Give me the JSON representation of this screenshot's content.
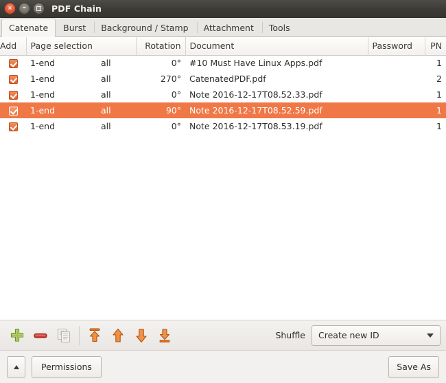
{
  "window": {
    "title": "PDF Chain",
    "controls": [
      {
        "name": "close",
        "glyph": "×"
      },
      {
        "name": "minimize",
        "glyph": "–"
      },
      {
        "name": "maximize",
        "glyph": ""
      }
    ]
  },
  "tabs": [
    {
      "label": "Catenate",
      "active": true
    },
    {
      "label": "Burst",
      "active": false
    },
    {
      "label": "Background / Stamp",
      "active": false
    },
    {
      "label": "Attachment",
      "active": false
    },
    {
      "label": "Tools",
      "active": false
    }
  ],
  "table": {
    "columns": [
      {
        "key": "add",
        "label": "Add"
      },
      {
        "key": "page",
        "label": "Page selection"
      },
      {
        "key": "rotation",
        "label": "Rotation"
      },
      {
        "key": "document",
        "label": "Document"
      },
      {
        "key": "password",
        "label": "Password"
      },
      {
        "key": "pn",
        "label": "PN"
      }
    ],
    "rows": [
      {
        "add": true,
        "page": "1-end",
        "all": "all",
        "rotation": "0°",
        "document": "#10 Must Have Linux Apps.pdf",
        "password": "",
        "pn": "1",
        "selected": false
      },
      {
        "add": true,
        "page": "1-end",
        "all": "all",
        "rotation": "270°",
        "document": "CatenatedPDF.pdf",
        "password": "",
        "pn": "2",
        "selected": false
      },
      {
        "add": true,
        "page": "1-end",
        "all": "all",
        "rotation": "0°",
        "document": "Note 2016-12-17T08.52.33.pdf",
        "password": "",
        "pn": "1",
        "selected": false
      },
      {
        "add": true,
        "page": "1-end",
        "all": "all",
        "rotation": "90°",
        "document": "Note 2016-12-17T08.52.59.pdf",
        "password": "",
        "pn": "1",
        "selected": true
      },
      {
        "add": true,
        "page": "1-end",
        "all": "all",
        "rotation": "0°",
        "document": "Note 2016-12-17T08.53.19.pdf",
        "password": "",
        "pn": "1",
        "selected": false
      }
    ]
  },
  "toolbar": {
    "buttons": [
      {
        "name": "add-file-button",
        "icon": "plus-icon",
        "enabled": true
      },
      {
        "name": "remove-file-button",
        "icon": "minus-icon",
        "enabled": true
      },
      {
        "name": "duplicate-button",
        "icon": "copy-pages-icon",
        "enabled": false
      },
      {
        "name": "move-top-button",
        "icon": "go-top-icon",
        "enabled": true
      },
      {
        "name": "move-up-button",
        "icon": "arrow-up-icon",
        "enabled": true
      },
      {
        "name": "move-down-button",
        "icon": "arrow-down-icon",
        "enabled": true
      },
      {
        "name": "move-bottom-button",
        "icon": "go-bottom-icon",
        "enabled": true
      }
    ],
    "shuffle_label": "Shuffle",
    "shuffle_value": "Create new ID"
  },
  "bottom": {
    "expander_icon": "caret-up-icon",
    "permissions_label": "Permissions",
    "save_as_label": "Save As"
  },
  "colors": {
    "selection": "#f07746",
    "titlebar": "#3c3b37",
    "checkbox": "#e2652c",
    "accent_arrow": "#e2711d",
    "plus_green": "#8db63c",
    "minus_red": "#cc3b34"
  }
}
